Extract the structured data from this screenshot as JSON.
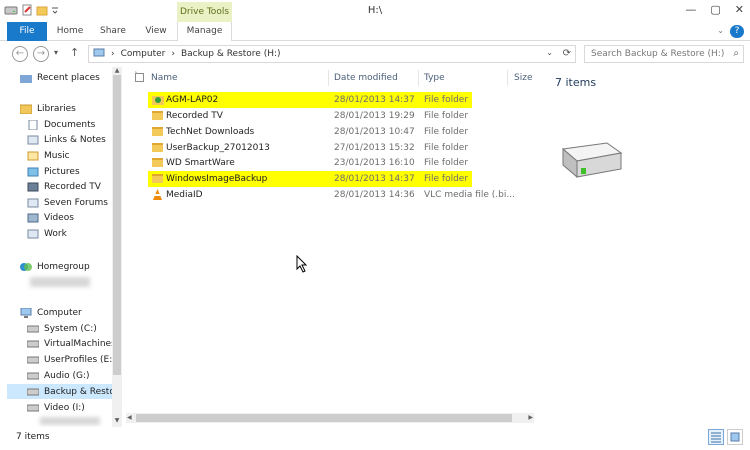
{
  "window": {
    "title": "H:\\",
    "context_tab": "Drive Tools",
    "controls": [
      "—",
      "▢",
      "✕"
    ]
  },
  "ribbon": {
    "tabs": [
      "File",
      "Home",
      "Share",
      "View",
      "Manage"
    ],
    "help": "?"
  },
  "navbar": {
    "back": "←",
    "forward": "→",
    "recent": "▾",
    "up": "↑",
    "path": [
      "Computer",
      "Backup & Restore (H:)"
    ],
    "separator": "›",
    "search_placeholder": "Search Backup & Restore (H:)"
  },
  "nav_pane": {
    "items": [
      {
        "label": "Recent places",
        "icon": "recent-places-icon"
      },
      {
        "label": "Libraries",
        "icon": "libraries-icon"
      },
      {
        "label": "Documents",
        "icon": "documents-icon"
      },
      {
        "label": "Links & Notes",
        "icon": "library-icon"
      },
      {
        "label": "Music",
        "icon": "music-icon"
      },
      {
        "label": "Pictures",
        "icon": "pictures-icon"
      },
      {
        "label": "Recorded TV",
        "icon": "recorded-tv-icon"
      },
      {
        "label": "Seven Forums",
        "icon": "library-icon"
      },
      {
        "label": "Videos",
        "icon": "videos-icon"
      },
      {
        "label": "Work",
        "icon": "library-icon"
      },
      {
        "label": "Homegroup",
        "icon": "homegroup-icon"
      },
      {
        "label": "Computer",
        "icon": "computer-icon"
      },
      {
        "label": "System (C:)",
        "icon": "drive-icon"
      },
      {
        "label": "VirtualMachines",
        "icon": "drive-icon"
      },
      {
        "label": "UserProfiles (E:)",
        "icon": "drive-icon"
      },
      {
        "label": "Audio (G:)",
        "icon": "drive-icon"
      },
      {
        "label": "Backup & Restor",
        "icon": "drive-icon"
      },
      {
        "label": "Video (I:)",
        "icon": "drive-icon"
      }
    ]
  },
  "columns": [
    "Name",
    "Date modified",
    "Type",
    "Size"
  ],
  "files": [
    {
      "name": "AGM-LAP02",
      "date": "28/01/2013 14:37",
      "type": "File folder",
      "icon": "backup-folder-icon",
      "highlighted": true
    },
    {
      "name": "Recorded TV",
      "date": "28/01/2013 19:29",
      "type": "File folder",
      "icon": "folder-icon",
      "highlighted": false
    },
    {
      "name": "TechNet Downloads",
      "date": "28/01/2013 10:47",
      "type": "File folder",
      "icon": "folder-icon",
      "highlighted": false
    },
    {
      "name": "UserBackup_27012013",
      "date": "27/01/2013 15:32",
      "type": "File folder",
      "icon": "folder-icon",
      "highlighted": false
    },
    {
      "name": "WD SmartWare",
      "date": "23/01/2013 16:10",
      "type": "File folder",
      "icon": "folder-icon",
      "highlighted": false
    },
    {
      "name": "WindowsImageBackup",
      "date": "28/01/2013 14:37",
      "type": "File folder",
      "icon": "folder-icon",
      "highlighted": true
    },
    {
      "name": "MediaID",
      "date": "28/01/2013 14:36",
      "type": "VLC media file (.bi...",
      "icon": "vlc-icon",
      "highlighted": false
    }
  ],
  "preview": {
    "count": "7 items"
  },
  "status": {
    "count": "7 items"
  },
  "colors": {
    "accent": "#1979ca",
    "highlight": "#ffff00",
    "selection": "#cce8ff"
  }
}
